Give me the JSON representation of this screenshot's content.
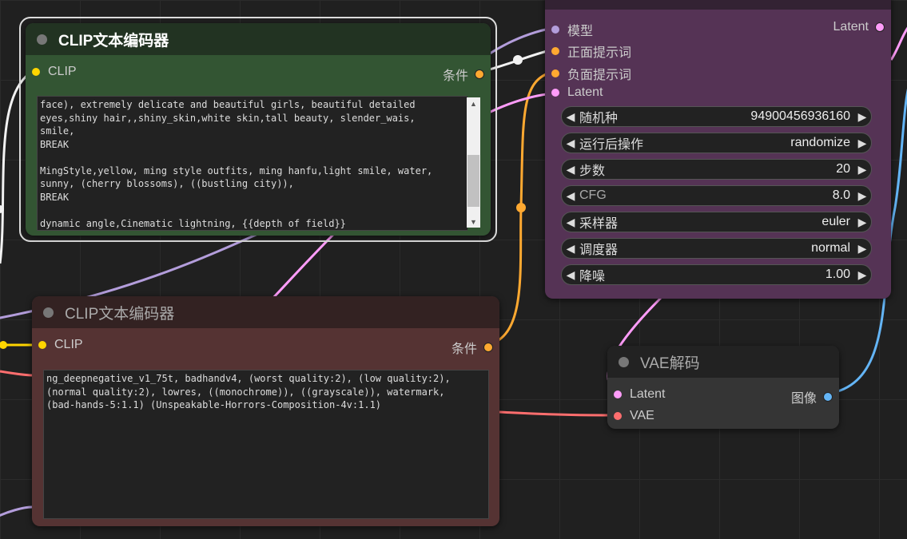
{
  "clip_node_positive": {
    "title": "CLIP文本编码器",
    "input_label": "CLIP",
    "output_label": "条件",
    "text": "face), extremely delicate and beautiful girls, beautiful detailed\neyes,shiny hair,,shiny_skin,white skin,tall beauty, slender_wais,\nsmile,\nBREAK\n\nMingStyle,yellow, ming style outfits, ming hanfu,light smile, water,\nsunny, (cherry blossoms), ((bustling city)),\nBREAK\n\ndynamic angle,Cinematic lightning, {{depth of field}}"
  },
  "clip_node_negative": {
    "title": "CLIP文本编码器",
    "input_label": "CLIP",
    "output_label": "条件",
    "text": "ng_deepnegative_v1_75t, badhandv4, (worst quality:2), (low quality:2),\n(normal quality:2), lowres, ((monochrome)), ((grayscale)), watermark,\n(bad-hands-5:1.1) (Unspeakable-Horrors-Composition-4v:1.1)"
  },
  "sampler_node": {
    "inputs": [
      "模型",
      "正面提示词",
      "负面提示词",
      "Latent"
    ],
    "output_label": "Latent",
    "widgets": [
      {
        "label": "随机种",
        "value": "94900456936160"
      },
      {
        "label": "运行后操作",
        "value": "randomize"
      },
      {
        "label": "步数",
        "value": "20"
      },
      {
        "label": "CFG",
        "value": "8.0"
      },
      {
        "label": "采样器",
        "value": "euler"
      },
      {
        "label": "调度器",
        "value": "normal"
      },
      {
        "label": "降噪",
        "value": "1.00"
      }
    ]
  },
  "vae_node": {
    "title": "VAE解码",
    "inputs": [
      "Latent",
      "VAE"
    ],
    "output_label": "图像"
  },
  "colors": {
    "clip_slot": "#ffd500",
    "conditioning_slot": "#ffa931",
    "model_slot": "#b39ddb",
    "latent_slot": "#ff9cf9",
    "vae_slot": "#ff6e6e",
    "image_slot": "#64b5f6",
    "positive_node": "#335533",
    "negative_node": "#553333",
    "sampler_node": "#553355"
  }
}
